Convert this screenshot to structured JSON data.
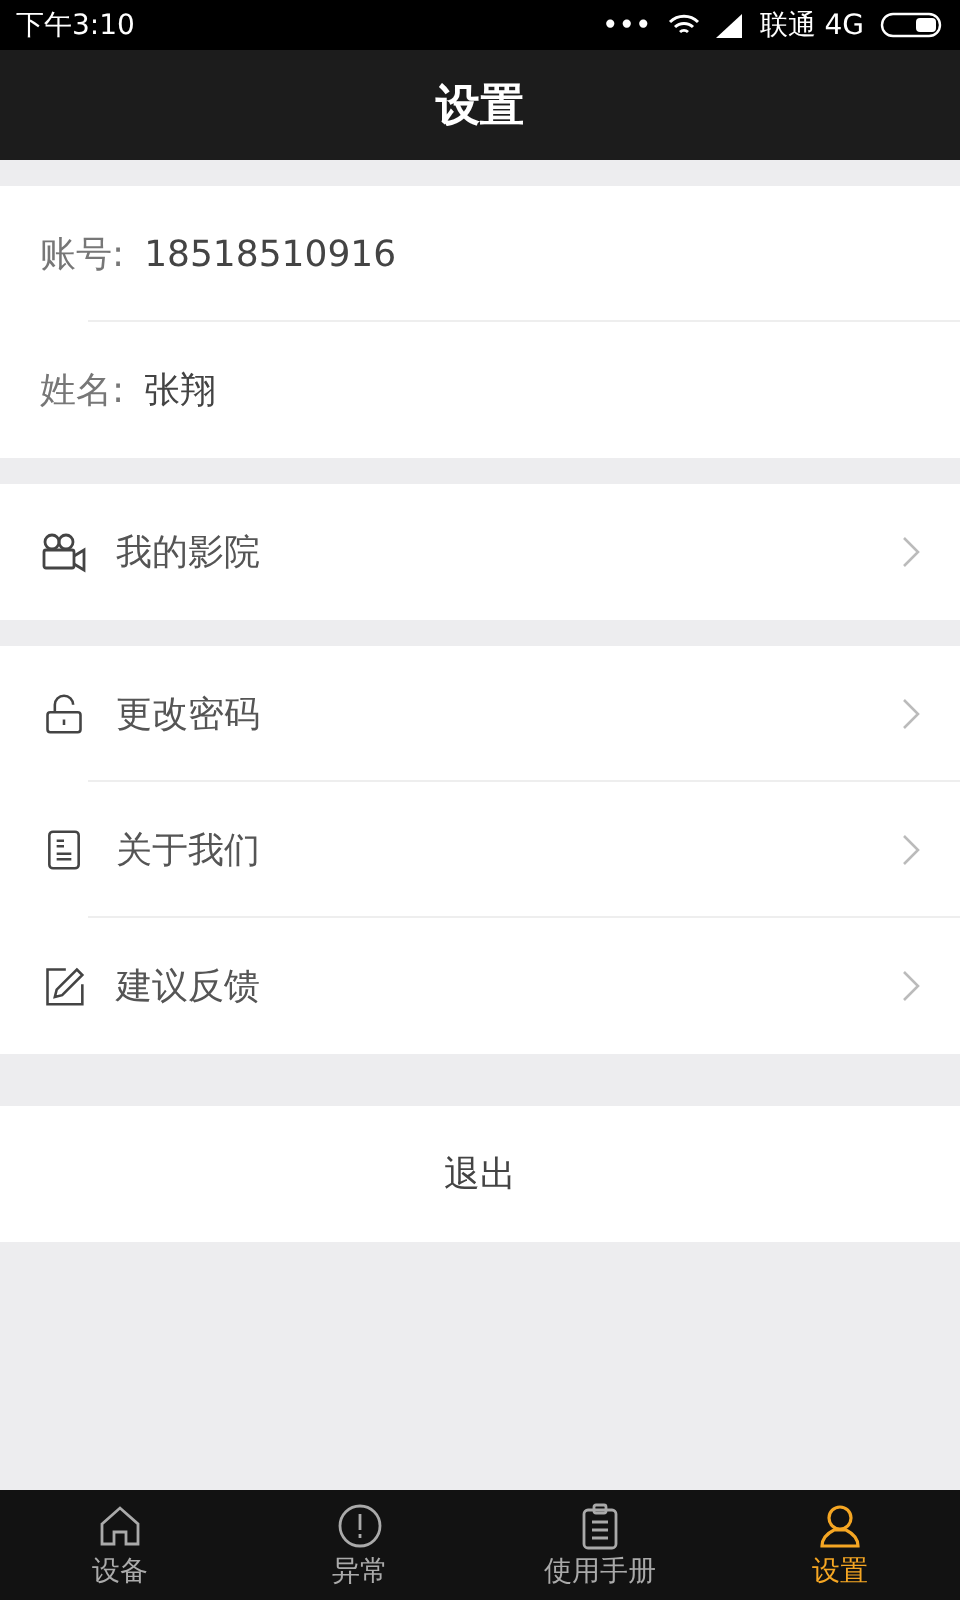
{
  "status_bar": {
    "time": "下午3:10",
    "more": "•••",
    "carrier": "联通 4G"
  },
  "header": {
    "title": "设置"
  },
  "profile": [
    {
      "label": "账号:",
      "value": "18518510916"
    },
    {
      "label": "姓名:",
      "value": "张翔"
    }
  ],
  "menu_groups": [
    [
      {
        "label": "我的影院"
      }
    ],
    [
      {
        "label": "更改密码"
      },
      {
        "label": "关于我们"
      },
      {
        "label": "建议反馈"
      }
    ]
  ],
  "logout": "退出",
  "tab_bar": [
    {
      "label": "设备",
      "selected": false
    },
    {
      "label": "异常",
      "selected": false
    },
    {
      "label": "使用手册",
      "selected": false
    },
    {
      "label": "设置",
      "selected": true
    }
  ]
}
